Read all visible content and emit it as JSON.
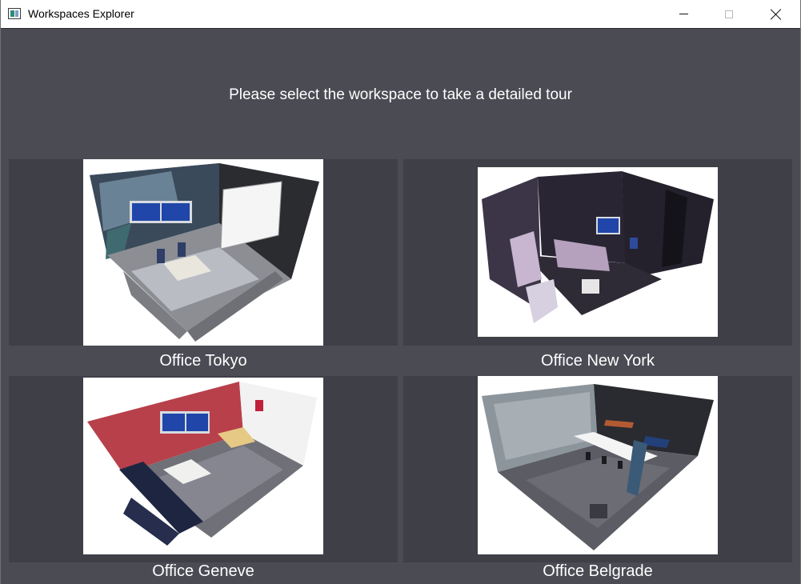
{
  "window": {
    "title": "Workspaces Explorer"
  },
  "heading": "Please select the workspace to take a detailed tour",
  "workspaces": [
    {
      "label": "Office Tokyo"
    },
    {
      "label": "Office New York"
    },
    {
      "label": "Office Geneve"
    },
    {
      "label": "Office Belgrade"
    }
  ],
  "colors": {
    "background": "#4a4b53",
    "tile": "#3e3f47",
    "text": "#ffffff",
    "titlebar": "#ffffff"
  },
  "icons": {
    "app": "app-window-icon",
    "minimize": "minimize-icon",
    "maximize": "maximize-icon",
    "close": "close-icon"
  }
}
